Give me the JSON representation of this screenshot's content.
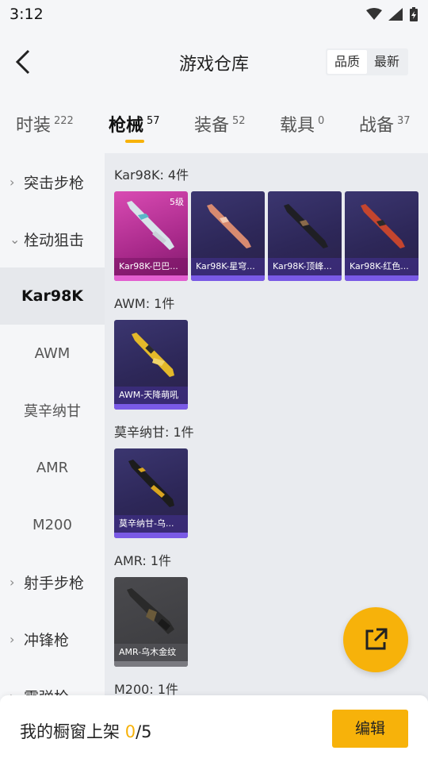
{
  "status_bar": {
    "time": "3:12"
  },
  "header": {
    "title": "游戏仓库",
    "sort_options": [
      "品质",
      "最新"
    ],
    "active_sort": "最新"
  },
  "tabs": [
    {
      "label": "时装",
      "count": "222"
    },
    {
      "label": "枪械",
      "count": "57"
    },
    {
      "label": "装备",
      "count": "52"
    },
    {
      "label": "载具",
      "count": "0"
    },
    {
      "label": "战备",
      "count": "37"
    }
  ],
  "active_tab": "枪械",
  "sidebar": {
    "items": [
      {
        "label": "突击步枪",
        "type": "category",
        "expanded": false
      },
      {
        "label": "栓动狙击",
        "type": "category",
        "expanded": true
      },
      {
        "label": "Kar98K",
        "type": "sub",
        "active": true
      },
      {
        "label": "AWM",
        "type": "sub"
      },
      {
        "label": "莫辛纳甘",
        "type": "sub"
      },
      {
        "label": "AMR",
        "type": "sub"
      },
      {
        "label": "M200",
        "type": "sub"
      },
      {
        "label": "射手步枪",
        "type": "category",
        "expanded": false
      },
      {
        "label": "冲锋枪",
        "type": "category",
        "expanded": false
      },
      {
        "label": "霰弹枪",
        "type": "category",
        "expanded": false
      }
    ]
  },
  "groups": [
    {
      "title": "Kar98K: 4件",
      "items": [
        {
          "name": "Kar98K-巴巴...",
          "quality": "pink",
          "level": "5级"
        },
        {
          "name": "Kar98K-星穹...",
          "quality": "purple"
        },
        {
          "name": "Kar98K-顶峰...",
          "quality": "purple"
        },
        {
          "name": "Kar98K-红色...",
          "quality": "purple"
        }
      ]
    },
    {
      "title": "AWM: 1件",
      "items": [
        {
          "name": "AWM-天降萌吼",
          "quality": "purple"
        }
      ]
    },
    {
      "title": "莫辛纳甘: 1件",
      "items": [
        {
          "name": "莫辛纳甘-乌...",
          "quality": "purple"
        }
      ]
    },
    {
      "title": "AMR: 1件",
      "items": [
        {
          "name": "AMR-乌木金纹",
          "quality": "grey"
        }
      ]
    },
    {
      "title": "M200: 1件",
      "items": []
    }
  ],
  "bottom_bar": {
    "label": "我的橱窗上架",
    "current": "0",
    "total": "/5",
    "edit_label": "编辑"
  },
  "colors": {
    "accent": "#f7b20a"
  },
  "icons": {
    "back": "back-arrow-icon",
    "share": "share-external-icon"
  }
}
